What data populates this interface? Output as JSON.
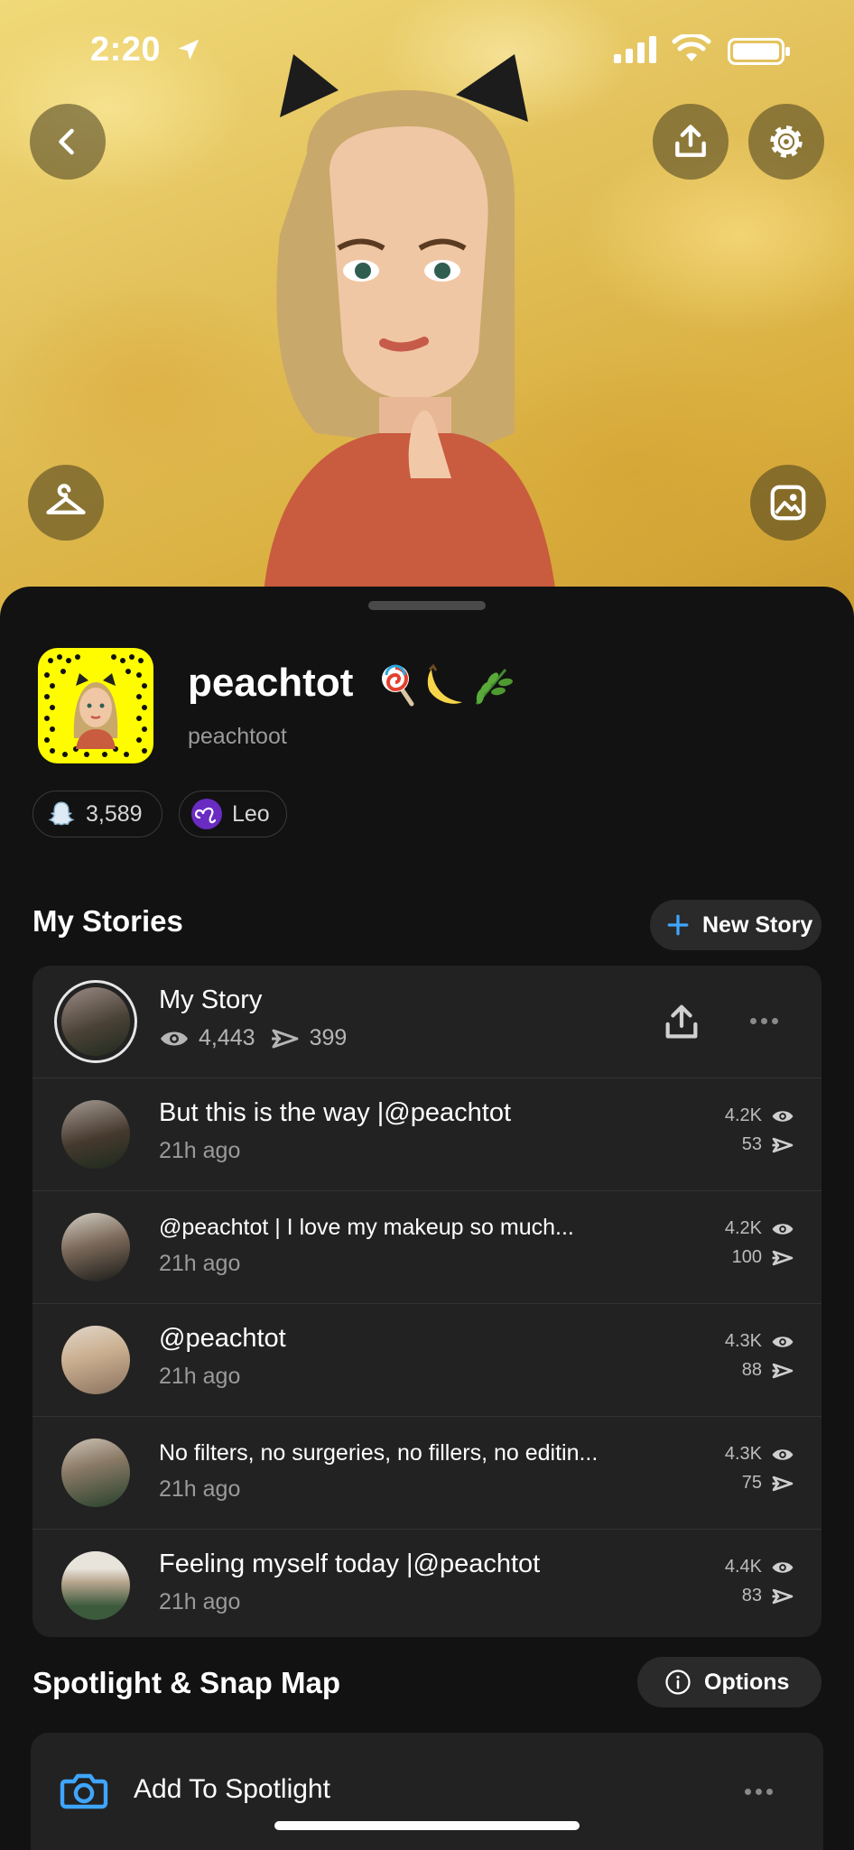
{
  "status_bar": {
    "time": "2:20"
  },
  "header_icons": {
    "back": "chevron-left-icon",
    "share": "share-icon",
    "settings": "gear-icon",
    "outfit": "hanger-icon",
    "background": "image-icon"
  },
  "profile": {
    "display_name": "peachtot",
    "emojis": "🍭🍌🌿",
    "username": "peachtoot",
    "snapscore": "3,589",
    "zodiac": "Leo"
  },
  "my_stories": {
    "title": "My Stories",
    "new_story_label": "New Story",
    "my_story": {
      "title": "My Story",
      "views": "4,443",
      "screenshots": "399"
    },
    "items": [
      {
        "title": "But this is the way  |@peachtot",
        "time": "21h ago",
        "views": "4.2K",
        "replies": "53"
      },
      {
        "title": "@peachtot  | I love my makeup so much...",
        "time": "21h ago",
        "views": "4.2K",
        "replies": "100"
      },
      {
        "title": "@peachtot",
        "time": "21h ago",
        "views": "4.3K",
        "replies": "88"
      },
      {
        "title": "No filters, no surgeries, no fillers, no editin...",
        "time": "21h ago",
        "views": "4.3K",
        "replies": "75"
      },
      {
        "title": "Feeling myself today  |@peachtot",
        "time": "21h ago",
        "views": "4.4K",
        "replies": "83"
      }
    ]
  },
  "spotlight": {
    "title": "Spotlight & Snap Map",
    "options_label": "Options",
    "add_label": "Add To Spotlight"
  },
  "colors": {
    "snap_yellow": "#fffc00",
    "accent_blue": "#3ea6ff",
    "sheet_bg": "#121212",
    "card_bg": "#222222"
  }
}
